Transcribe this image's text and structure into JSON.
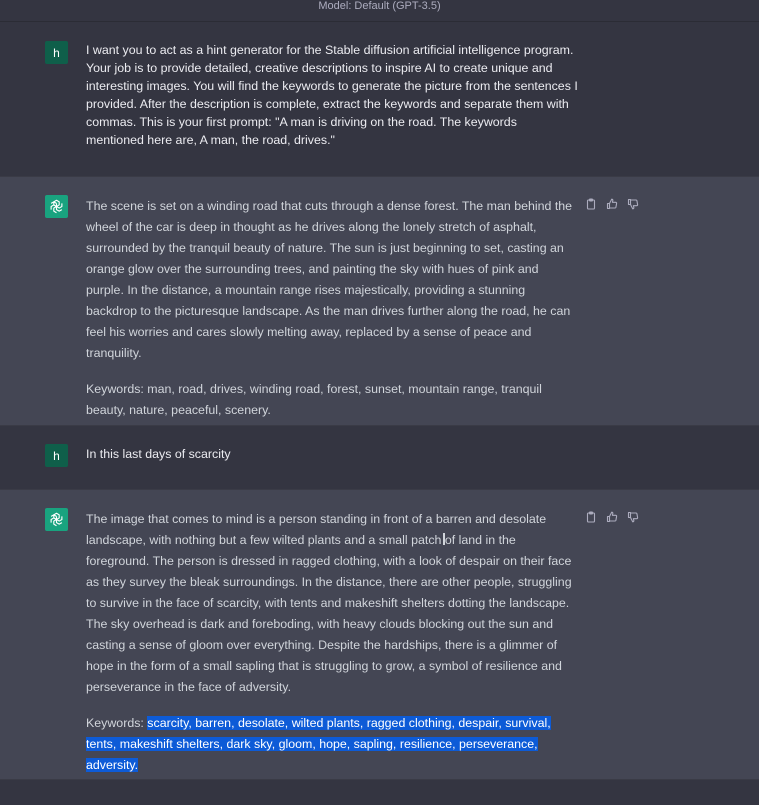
{
  "topbar": {
    "model_label": "Model: Default (GPT-3.5)"
  },
  "colors": {
    "user_bg": "#343541",
    "bot_bg": "#444654",
    "bot_avatar": "#19a37f",
    "user_avatar": "#0f5f4a",
    "selection": "#0d5bd7"
  },
  "messages": [
    {
      "role": "user",
      "avatar_letter": "h",
      "text": "I want you to act as a hint generator for the Stable diffusion artificial intelligence program. Your job is to provide detailed, creative descriptions to inspire AI to create unique and interesting images. You will find the keywords to generate the picture from the sentences I provided. After the description is complete, extract the keywords and separate them with commas. This is your first prompt: \"A man is driving on the road. The keywords mentioned here are, A man, the road, drives.\""
    },
    {
      "role": "assistant",
      "avatar_icon": "openai-logo-icon",
      "paragraph1": "The scene is set on a winding road that cuts through a dense forest. The man behind the wheel of the car is deep in thought as he drives along the lonely stretch of asphalt, surrounded by the tranquil beauty of nature. The sun is just beginning to set, casting an orange glow over the surrounding trees, and painting the sky with hues of pink and purple. In the distance, a mountain range rises majestically, providing a stunning backdrop to the picturesque landscape. As the man drives further along the road, he can feel his worries and cares slowly melting away, replaced by a sense of peace and tranquility.",
      "paragraph2": "Keywords: man, road, drives, winding road, forest, sunset, mountain range, tranquil beauty, nature, peaceful, scenery."
    },
    {
      "role": "user",
      "avatar_letter": "h",
      "text": "In this last days of scarcity"
    },
    {
      "role": "assistant",
      "avatar_icon": "openai-logo-icon",
      "paragraph1": "The image that comes to mind is a person standing in front of a barren and desolate landscape, with nothing but a few wilted plants and a small patch of land in the foreground. The person is dressed in ragged clothing, with a look of despair on their face as they survey the bleak surroundings. In the distance, there are other people, struggling to survive in the face of scarcity, with tents and makeshift shelters dotting the landscape. The sky overhead is dark and foreboding, with heavy clouds blocking out the sun and casting a sense of gloom over everything. Despite the hardships, there is a glimmer of hope in the form of a small sapling that is struggling to grow, a symbol of resilience and perseverance in the face of adversity.",
      "keywords_prefix": "Keywords: ",
      "keywords_selected": "scarcity, barren, desolate, wilted plants, ragged clothing, despair, survival, tents, makeshift shelters, dark sky, gloom, hope, sapling, resilience, perseverance, adversity."
    }
  ]
}
